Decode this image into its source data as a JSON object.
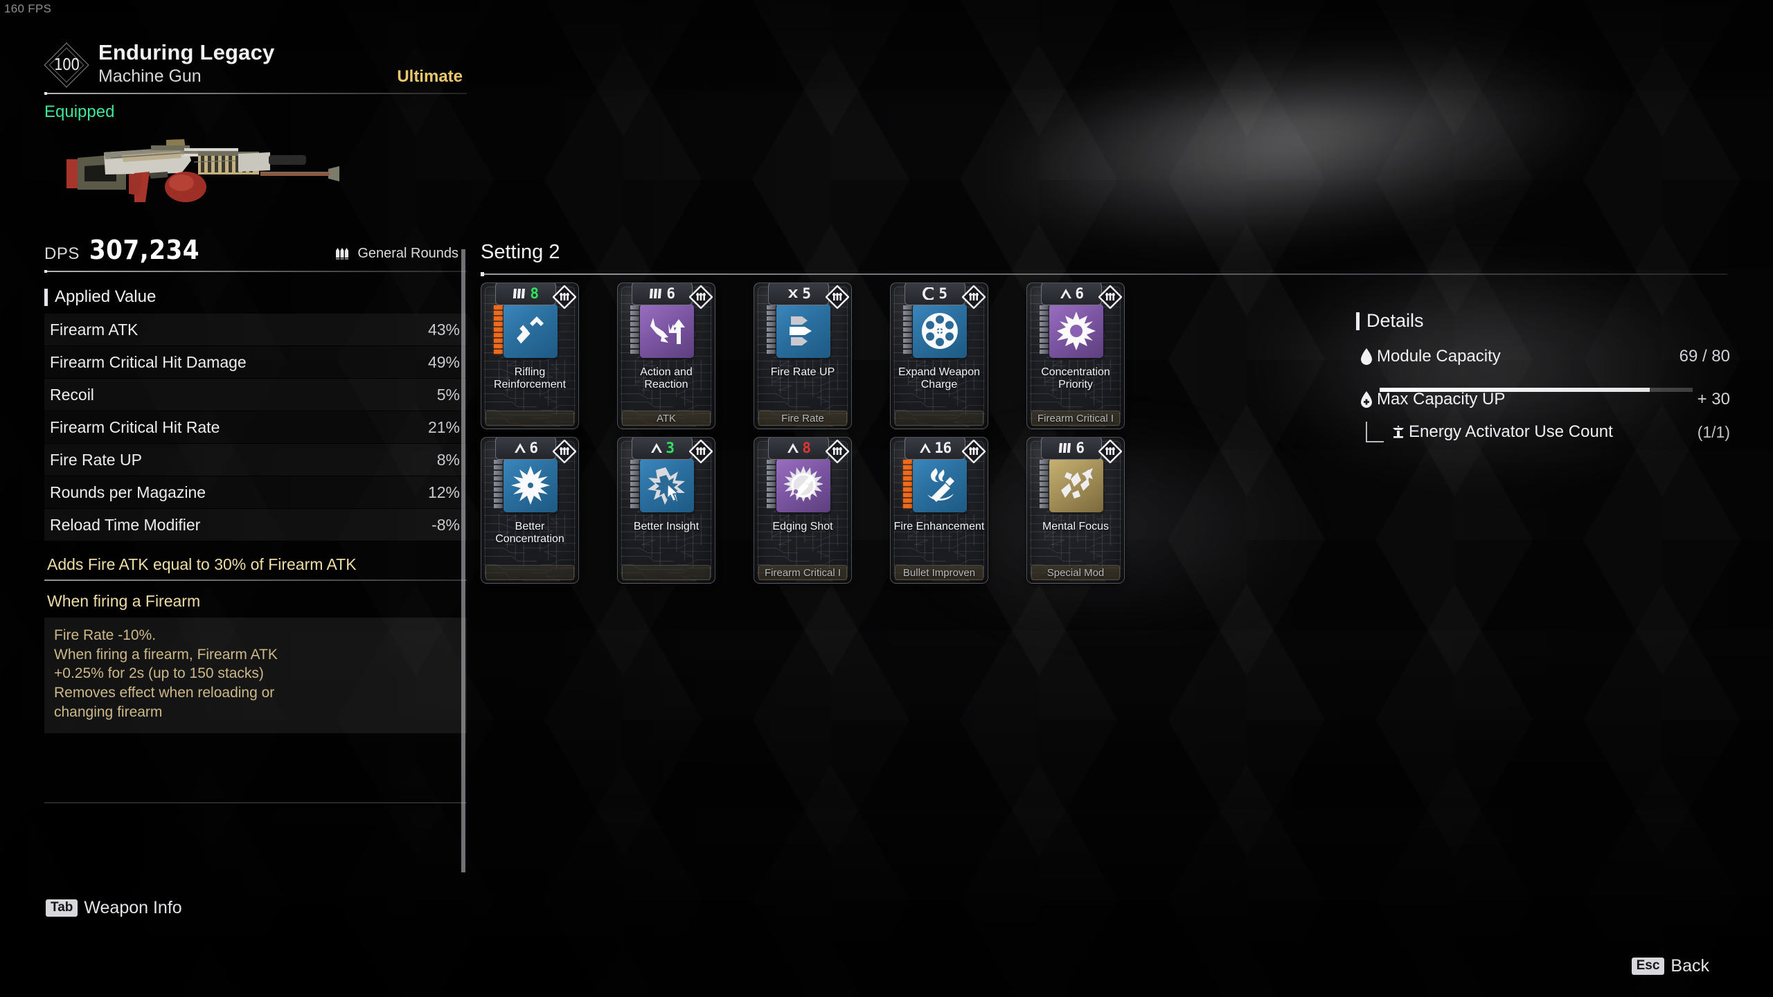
{
  "hud": {
    "fps": "160 FPS"
  },
  "weapon": {
    "level": "100",
    "name": "Enduring Legacy",
    "type": "Machine Gun",
    "tier": "Ultimate",
    "status": "Equipped",
    "dps_label": "DPS",
    "dps_value": "307,234",
    "ammo_type": "General Rounds",
    "ammo_icon": "bullets-icon",
    "applied_value_title": "Applied Value",
    "stats": [
      {
        "name": "Firearm ATK",
        "value": "43%"
      },
      {
        "name": "Firearm Critical Hit Damage",
        "value": "49%"
      },
      {
        "name": "Recoil",
        "value": "5%"
      },
      {
        "name": "Firearm Critical Hit Rate",
        "value": "21%"
      },
      {
        "name": "Fire Rate UP",
        "value": "8%"
      },
      {
        "name": "Rounds per Magazine",
        "value": "12%"
      },
      {
        "name": "Reload Time Modifier",
        "value": "-8%"
      }
    ],
    "passive_title": "Adds Fire ATK equal to 30% of Firearm ATK",
    "trigger_title": "When firing a Firearm",
    "effect_lines": [
      "Fire Rate -10%.",
      "When firing a firearm, Firearm ATK",
      "+0.25% for 2s (up to 150 stacks)",
      "Removes effect when reloading or",
      "changing firearm"
    ]
  },
  "setting": {
    "title": "Setting 2",
    "modules": [
      {
        "name": "Rifling Reinforcement",
        "level": "8",
        "level_color": "#2fe35c",
        "tier_icon": "bars-tier-icon",
        "tile": "tile-blue",
        "icon": "rifling-bullet-up-icon",
        "category": "",
        "stacks_on": 9,
        "stacks_total": 9
      },
      {
        "name": "Action and Reaction",
        "level": "6",
        "level_color": "#f2f2f5",
        "tier_icon": "bars-tier-icon",
        "tile": "tile-purple",
        "icon": "arrow-down-up-icon",
        "category": "ATK",
        "stacks_on": 0,
        "stacks_total": 9
      },
      {
        "name": "Fire Rate UP",
        "level": "5",
        "level_color": "#f2f2f5",
        "tier_icon": "cross-tier-icon",
        "tile": "tile-blue",
        "icon": "three-bullets-icon",
        "category": "Fire Rate",
        "stacks_on": 0,
        "stacks_total": 9
      },
      {
        "name": "Expand Weapon Charge",
        "level": "5",
        "level_color": "#f2f2f5",
        "tier_icon": "c-tier-icon",
        "tile": "tile-blue",
        "icon": "revolver-cylinder-icon",
        "category": "",
        "stacks_on": 0,
        "stacks_total": 9
      },
      {
        "name": "Concentration Priority",
        "level": "6",
        "level_color": "#f2f2f5",
        "tier_icon": "chevron-tier-icon",
        "tile": "tile-purple",
        "icon": "starburst-crit-icon",
        "category": "Firearm Critical I",
        "stacks_on": 0,
        "stacks_total": 9
      },
      {
        "name": "Better Concentration",
        "level": "6",
        "level_color": "#f2f2f5",
        "tier_icon": "chevron-tier-icon",
        "tile": "tile-blue",
        "icon": "starburst-icon",
        "category": "",
        "stacks_on": 0,
        "stacks_total": 9
      },
      {
        "name": "Better Insight",
        "level": "3",
        "level_color": "#2fe35c",
        "tier_icon": "chevron-tier-icon",
        "tile": "tile-blue",
        "icon": "burst-cursor-icon",
        "category": "",
        "stacks_on": 0,
        "stacks_total": 9
      },
      {
        "name": "Edging Shot",
        "level": "8",
        "level_color": "#e03434",
        "tier_icon": "chevron-tier-icon",
        "tile": "tile-purple",
        "icon": "spiked-bullet-icon",
        "category": "Firearm Critical I",
        "stacks_on": 0,
        "stacks_total": 9
      },
      {
        "name": "Fire Enhancement",
        "level": "16",
        "level_color": "#f2f2f5",
        "tier_icon": "chevron-tier-icon",
        "tile": "tile-blue",
        "icon": "flame-bullet-icon",
        "category": "Bullet Improven",
        "stacks_on": 9,
        "stacks_total": 9
      },
      {
        "name": "Mental Focus",
        "level": "6",
        "level_color": "#f2f2f5",
        "tier_icon": "bars-tier-icon",
        "tile": "tile-gold",
        "icon": "shards-arrow-icon",
        "category": "Special Mod",
        "stacks_on": 0,
        "stacks_total": 9
      }
    ]
  },
  "details": {
    "title": "Details",
    "module_capacity_label": "Module Capacity",
    "module_capacity_value": "69 / 80",
    "module_capacity_used": 69,
    "module_capacity_max": 80,
    "max_capacity_label": "Max Capacity UP",
    "max_capacity_value": "+ 30",
    "energy_activator_label": "Energy Activator Use Count",
    "energy_activator_value": "(1/1)"
  },
  "hints": {
    "weapon_info_key": "Tab",
    "weapon_info_label": "Weapon Info",
    "back_key": "Esc",
    "back_label": "Back"
  },
  "colors": {
    "accent_tier": "#e8c86a",
    "equipped": "#3fe49a",
    "stack_on": "#ef6a1a",
    "effect_text": "#cdb888"
  }
}
